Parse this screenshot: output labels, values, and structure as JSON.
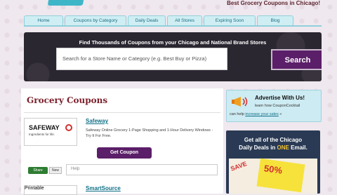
{
  "header": {
    "tagline": "Best Grocery Coupons in Chicago!"
  },
  "nav": [
    {
      "label": "Home"
    },
    {
      "label": "Coupons by Category"
    },
    {
      "label": "Daily Deals"
    },
    {
      "label": "All Stores"
    },
    {
      "label": "Expiring Soon"
    },
    {
      "label": "Blog"
    }
  ],
  "hero": {
    "title": "Find Thousands of Coupons from your Chicago and National Brand Stores",
    "search_placeholder": "Search for a Store Name or Category (e.g. Best Buy or Pizza)",
    "search_button": "Search"
  },
  "content": {
    "page_title": "Grocery Coupons",
    "listings": [
      {
        "logo_name": "SAFEWAY",
        "logo_sub": "Ingredients for life.",
        "name": "Safeway",
        "description": "Safeway Online Grocery 1-Page Shopping and 1-Hour Delivery Windows - Try It For Free.",
        "button": "Get Coupon",
        "share": "Share",
        "new": "New",
        "help_placeholder": "Help"
      },
      {
        "logo_name": "Printable",
        "name": "SmartSource"
      }
    ]
  },
  "sidebar": {
    "advertise_title": "Advertise With Us!",
    "advertise_sub": "learn how CouponCocktail",
    "advertise_sub2_prefix": "can help ",
    "advertise_link": "increase your sales",
    "advertise_sub2_suffix": " »",
    "deals_title_part1": "Get all of the Chicago",
    "deals_title_part2a": "Daily Deals in ",
    "deals_title_one": "ONE",
    "deals_title_part2b": " Email.",
    "coupon_pct": "50%",
    "coupon_save": "SAVE"
  }
}
